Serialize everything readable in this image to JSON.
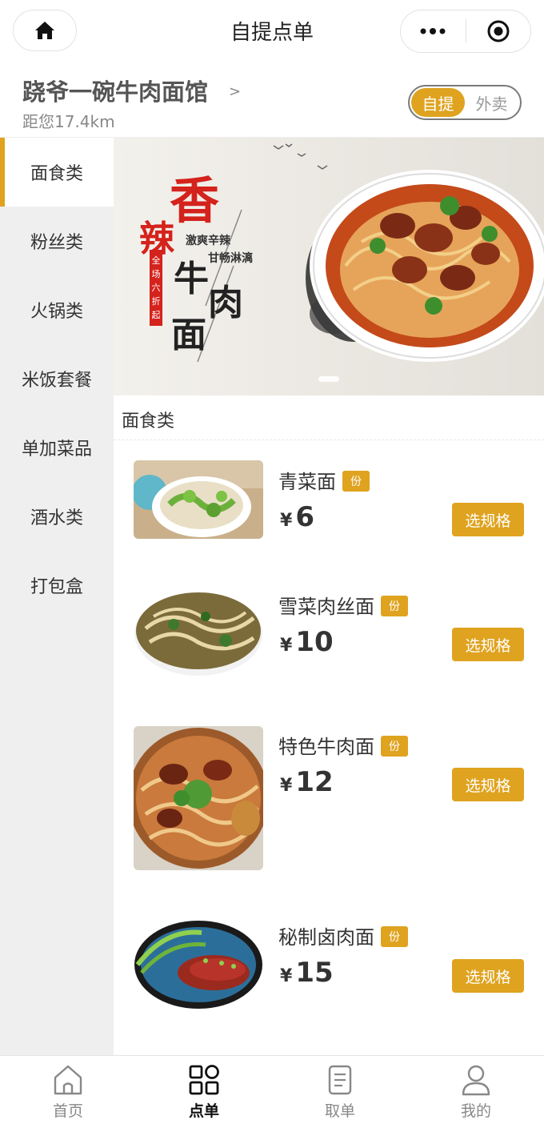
{
  "nav": {
    "title": "自提点单",
    "home_icon": "home-icon",
    "more_icon": "more-icon",
    "close_icon": "record-icon"
  },
  "shop": {
    "name": "跷爷一碗牛肉面馆",
    "arrow": ">",
    "distance": "距您17.4km",
    "mode_options": [
      "自提",
      "外卖"
    ],
    "selected_mode": "自提"
  },
  "categories": [
    "面食类",
    "粉丝类",
    "火锅类",
    "米饭套餐",
    "单加菜品",
    "酒水类",
    "打包盒"
  ],
  "active_category": "面食类",
  "banner": {
    "title_chars": [
      "香",
      "辣",
      "牛",
      "肉",
      "面"
    ],
    "slogan_1": "激爽辛辣",
    "slogan_2": "甘畅淋漓",
    "seal": "全场六折起"
  },
  "section_title": "面食类",
  "menu": [
    {
      "name": "青菜面",
      "unit": "份",
      "currency": "¥",
      "price": "6",
      "button": "选规格"
    },
    {
      "name": "雪菜肉丝面",
      "unit": "份",
      "currency": "¥",
      "price": "10",
      "button": "选规格"
    },
    {
      "name": "特色牛肉面",
      "unit": "份",
      "currency": "¥",
      "price": "12",
      "button": "选规格"
    },
    {
      "name": "秘制卤肉面",
      "unit": "份",
      "currency": "¥",
      "price": "15",
      "button": "选规格"
    }
  ],
  "tabs": [
    {
      "label": "首页",
      "icon": "home-icon"
    },
    {
      "label": "点单",
      "icon": "grid-icon"
    },
    {
      "label": "取单",
      "icon": "document-icon"
    },
    {
      "label": "我的",
      "icon": "user-icon"
    }
  ],
  "active_tab": "点单",
  "colors": {
    "accent": "#dfa31f",
    "sidebar_bg": "#efefef"
  }
}
